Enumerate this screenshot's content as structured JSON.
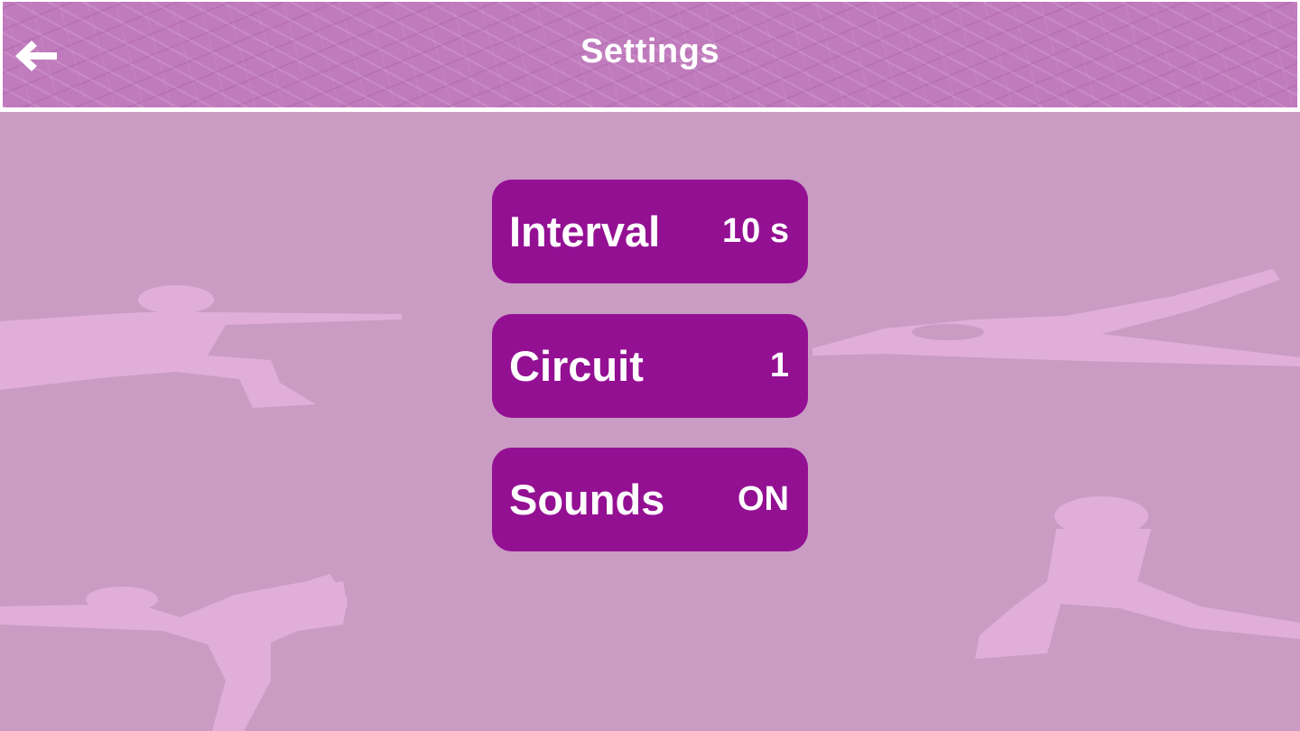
{
  "header": {
    "title": "Settings",
    "back_icon": "arrow-left-icon"
  },
  "settings": [
    {
      "label": "Interval",
      "value": "10 s"
    },
    {
      "label": "Circuit",
      "value": "1"
    },
    {
      "label": "Sounds",
      "value": "ON"
    }
  ],
  "colors": {
    "header_bg": "#c07bbd",
    "main_bg": "#ca9cc4",
    "button_bg": "#941093",
    "silhouette": "#e0aed9",
    "text": "#ffffff"
  }
}
